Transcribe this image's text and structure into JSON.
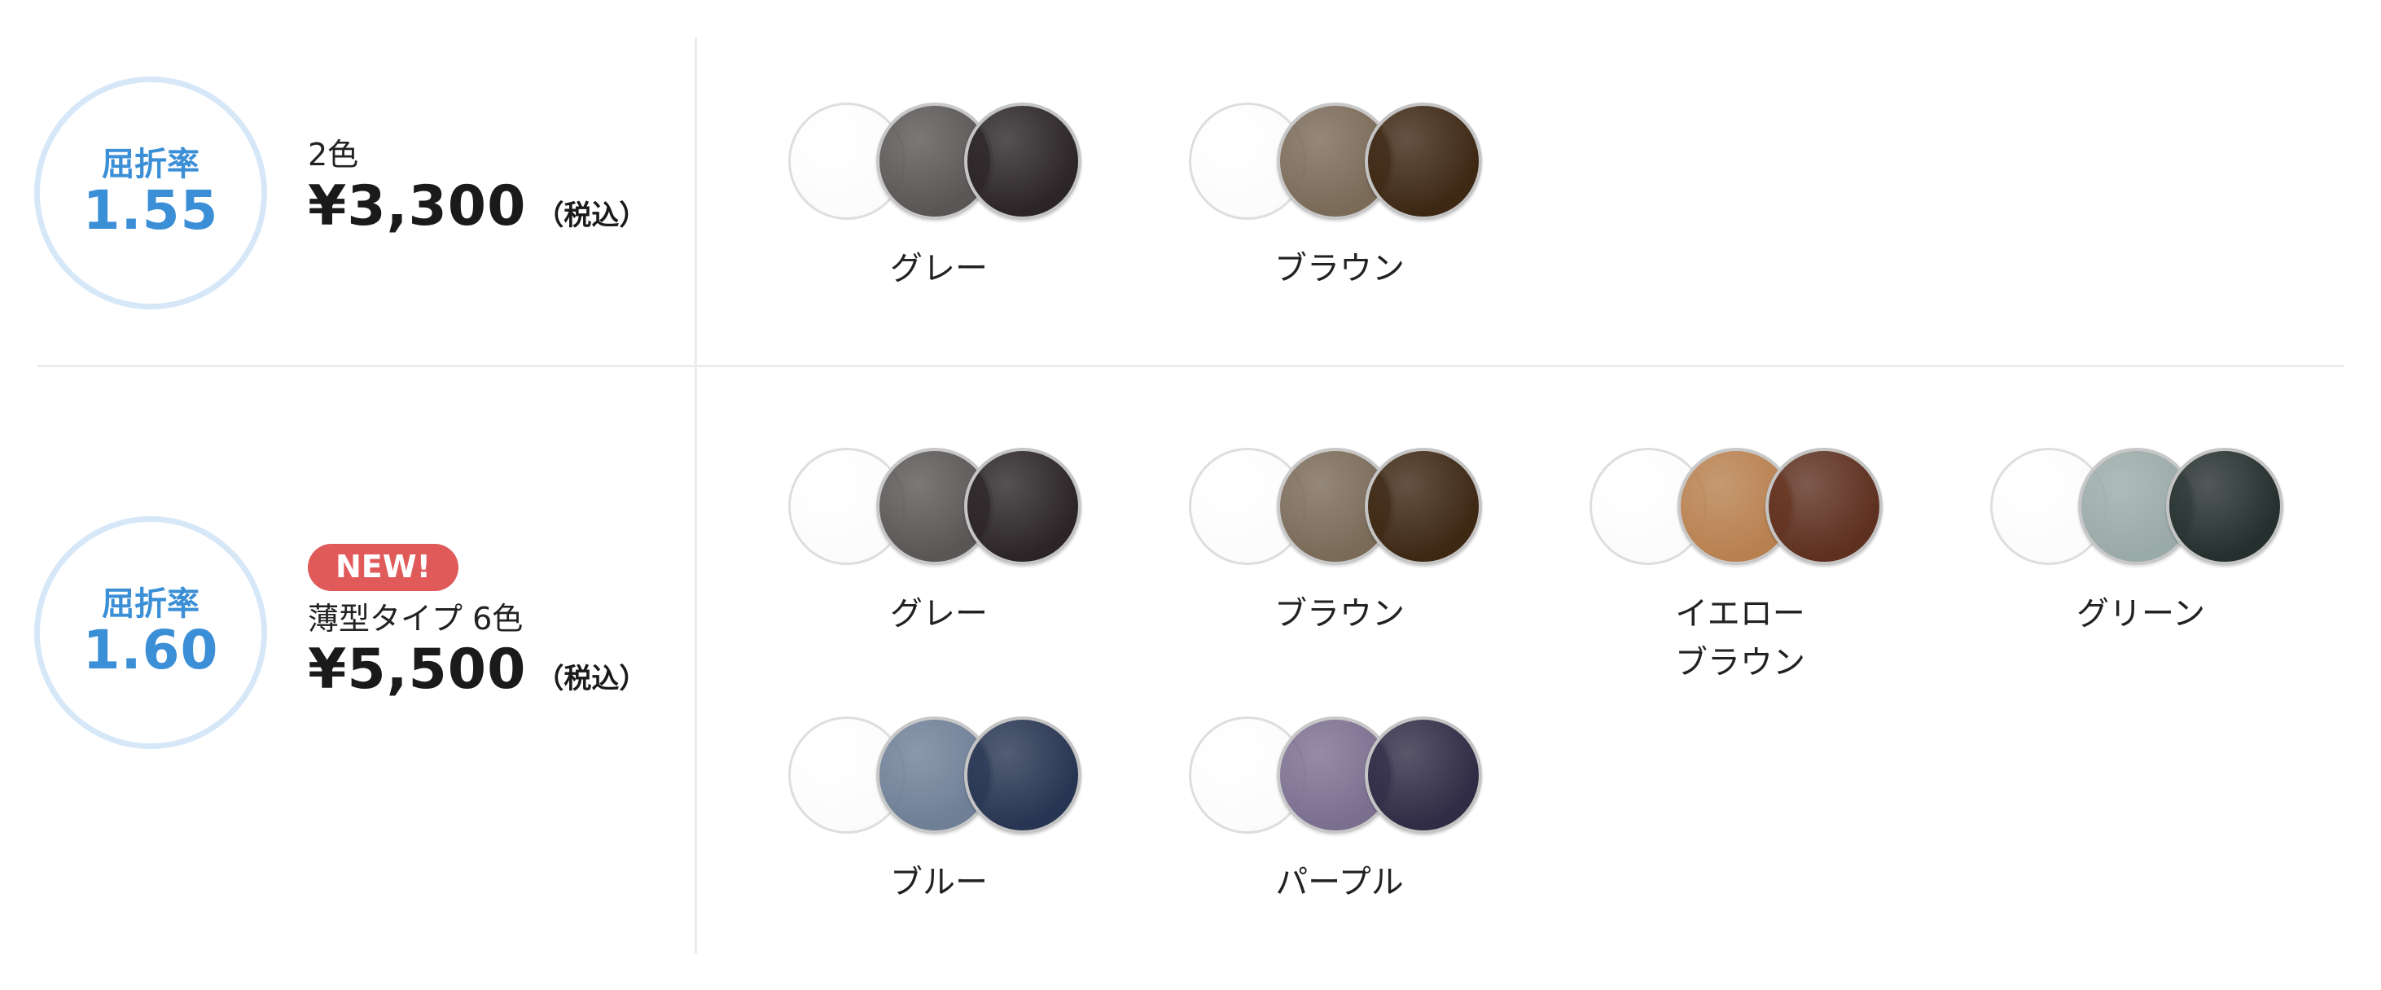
{
  "rows": [
    {
      "badge": {
        "label": "屈折率",
        "index": "1.55"
      },
      "note": "2色",
      "price": "¥3,300",
      "tax": "（税込）",
      "lenses": [
        {
          "name": "グレー",
          "mid_color": "#5a5656",
          "dark_color": "#2b2528"
        },
        {
          "name": "ブラウン",
          "mid_color": "#7a6a58",
          "dark_color": "#3d2814"
        }
      ]
    },
    {
      "badge": {
        "label": "屈折率",
        "index": "1.60"
      },
      "new_tag": "NEW!",
      "note": "薄型タイプ 6色",
      "price": "¥5,500",
      "tax": "（税込）",
      "lenses": [
        {
          "name": "グレー",
          "mid_color": "#5a5656",
          "dark_color": "#2b2528"
        },
        {
          "name": "ブラウン",
          "mid_color": "#7a6a58",
          "dark_color": "#3d2814"
        },
        {
          "name": "イエロー\nブラウン",
          "mid_color": "#b8804f",
          "dark_color": "#5e3020"
        },
        {
          "name": "グリーン",
          "mid_color": "#9aaaa8",
          "dark_color": "#25302e"
        },
        {
          "name": "ブルー",
          "mid_color": "#6e7f96",
          "dark_color": "#283552"
        },
        {
          "name": "パープル",
          "mid_color": "#7b6f90",
          "dark_color": "#312c45"
        }
      ]
    }
  ],
  "colors": {
    "badge_text": "#3b8fd6",
    "badge_ring": "#d6e8f8",
    "new_tag_bg": "#e05a5a",
    "divider": "#ececec"
  }
}
